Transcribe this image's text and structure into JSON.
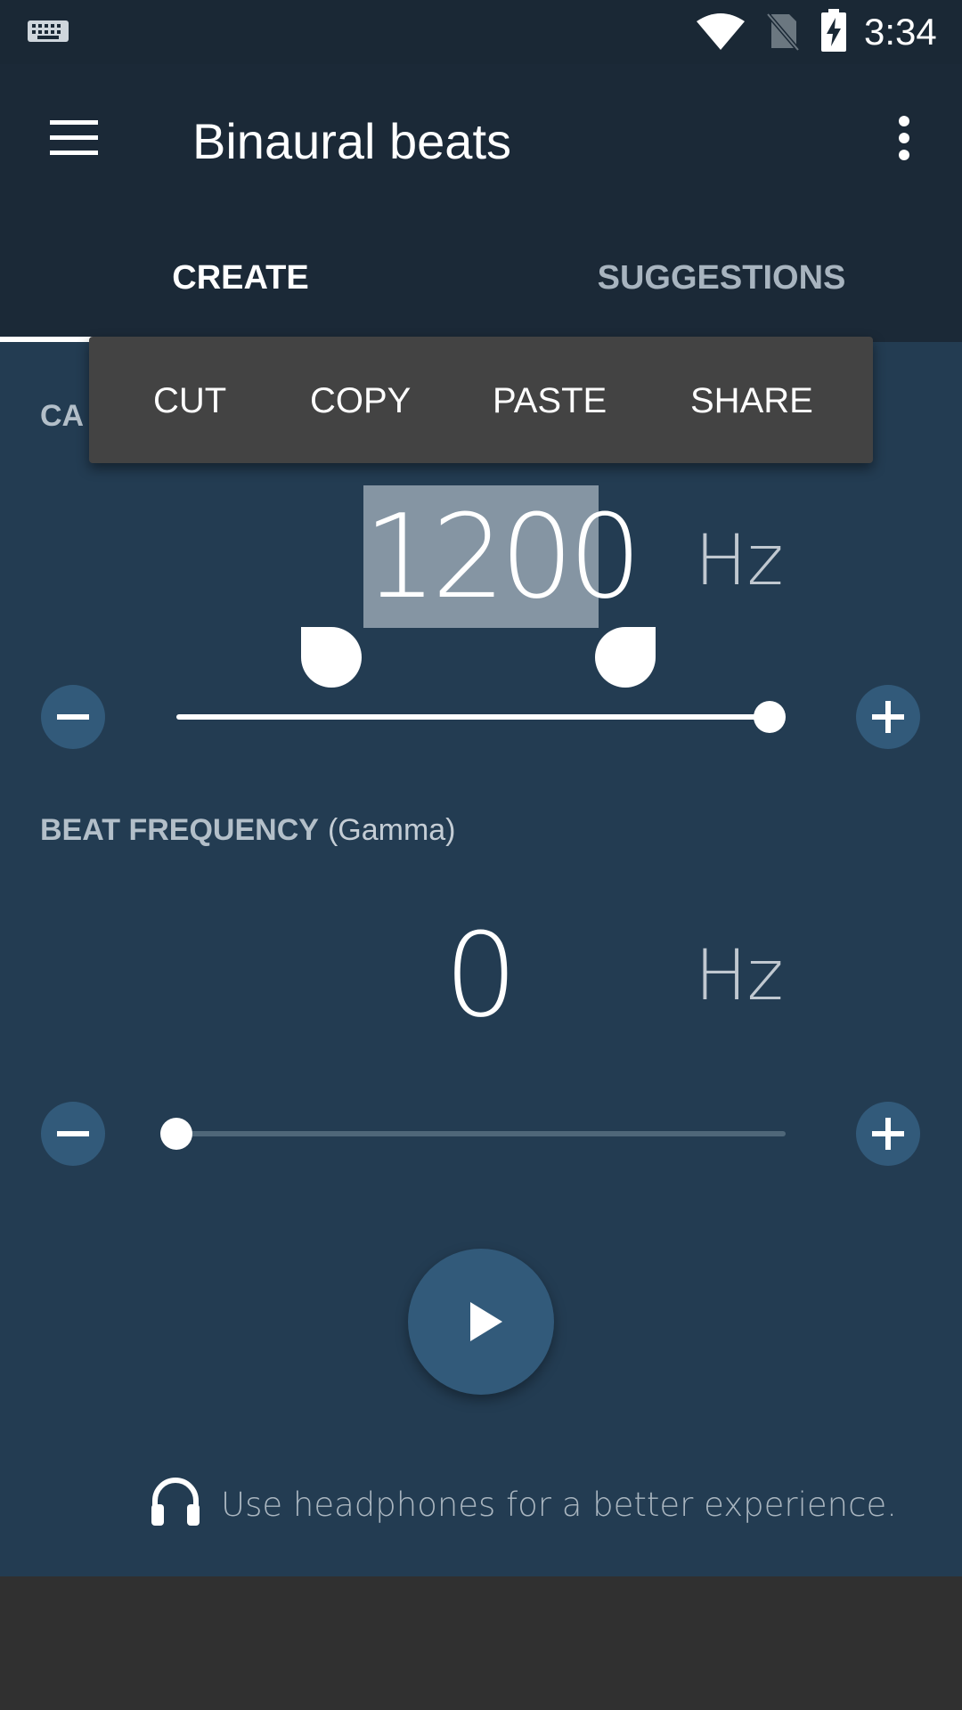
{
  "status_bar": {
    "time": "3:34",
    "icons": [
      "keyboard-icon",
      "wifi-icon",
      "no-sim-icon",
      "battery-charging-icon"
    ]
  },
  "app_bar": {
    "title": "Binaural beats",
    "menu_icon": "hamburger-menu-icon",
    "overflow_icon": "more-vert-icon"
  },
  "tabs": [
    {
      "label": "CREATE",
      "selected": true
    },
    {
      "label": "SUGGESTIONS",
      "selected": false
    }
  ],
  "context_menu": {
    "items": [
      "CUT",
      "COPY",
      "PASTE",
      "SHARE"
    ]
  },
  "carrier": {
    "label_partial": "CA",
    "value": "1200",
    "unit": "Hz",
    "slider_fraction": 1.0
  },
  "beat": {
    "label": "BEAT FREQUENCY",
    "sub_label": "(Gamma)",
    "value": "0",
    "unit": "Hz",
    "slider_fraction": 0.0
  },
  "controls": {
    "minus_icon": "minus-icon",
    "plus_icon": "plus-icon",
    "play_icon": "play-icon"
  },
  "footer": {
    "hint": "Use headphones for a better experience.",
    "icon": "headphones-icon"
  },
  "colors": {
    "status_bar": "#1a2835",
    "app_bar": "#1b2937",
    "content": "#233c52",
    "button": "#325a7a",
    "menu": "#434343",
    "nav_area": "#303030"
  }
}
